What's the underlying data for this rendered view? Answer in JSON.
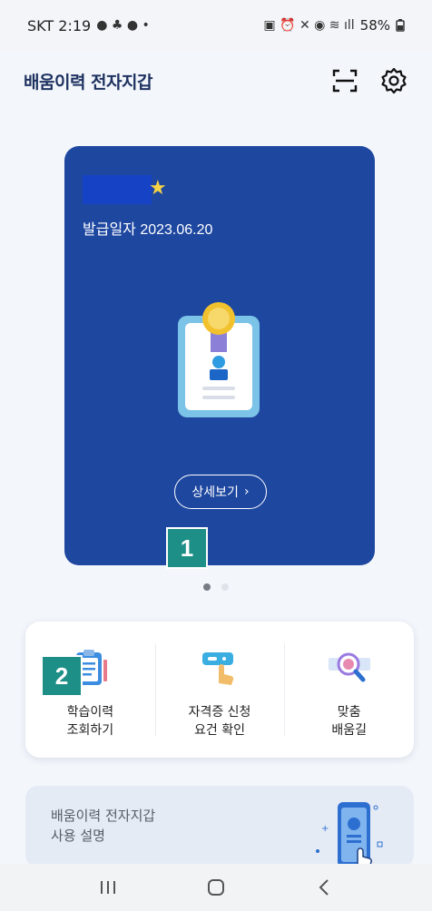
{
  "status_bar": {
    "carrier_time": "SKT 2:19",
    "battery": "58%"
  },
  "header": {
    "title": "배움이력 전자지갑",
    "scan_icon": "scan-icon",
    "settings_icon": "gear-icon"
  },
  "card": {
    "issue_date": "발급일자 2023.06.20",
    "detail_button": "상세보기",
    "star_icon": "star-icon",
    "pager_total": 2,
    "pager_active": 1
  },
  "markers": {
    "one": "1",
    "two": "2"
  },
  "menu": {
    "items": [
      {
        "label_line1": "학습이력",
        "label_line2": "조회하기",
        "icon": "clipboard-icon"
      },
      {
        "label_line1": "자격증 신청",
        "label_line2": "요건 확인",
        "icon": "card-hand-icon"
      },
      {
        "label_line1": "맞춤",
        "label_line2": "배움길",
        "icon": "magnifier-icon"
      }
    ]
  },
  "guide": {
    "line1": "배움이력 전자지갑",
    "line2": "사용 설명",
    "icon": "phone-touch-icon"
  },
  "nav": {
    "recents_icon": "recents-icon",
    "home_icon": "home-icon",
    "back_icon": "back-icon"
  },
  "colors": {
    "card_bg": "#1e47a0",
    "title": "#1e3260",
    "marker": "#1e8f87",
    "star": "#f7d348"
  }
}
